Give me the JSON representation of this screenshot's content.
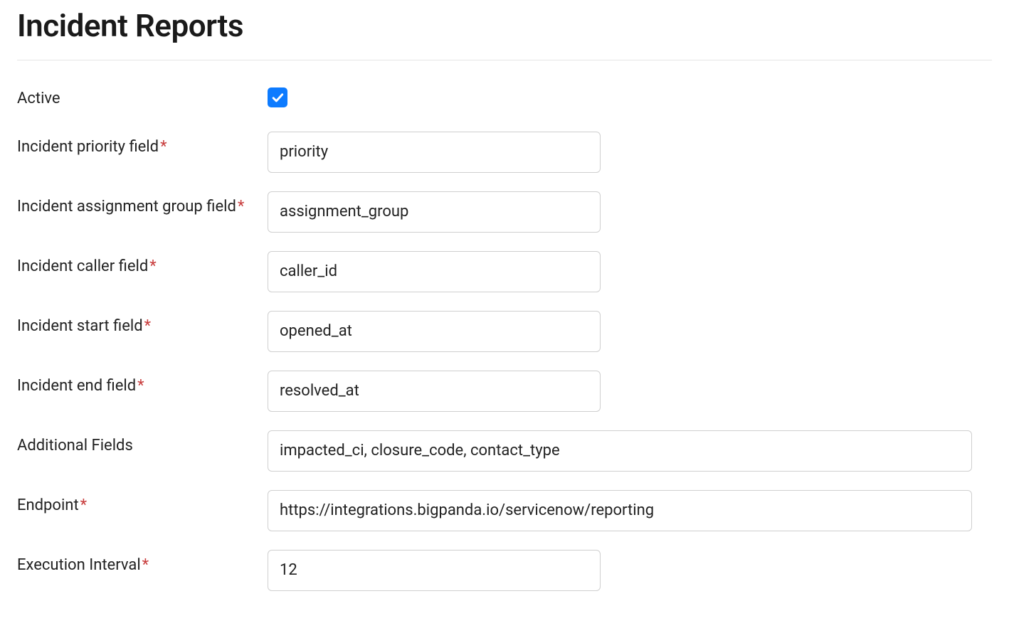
{
  "title": "Incident Reports",
  "fields": {
    "active": {
      "label": "Active",
      "checked": true
    },
    "priority": {
      "label": "Incident priority field",
      "required": true,
      "value": "priority"
    },
    "assignment_group": {
      "label": "Incident assignment group field",
      "required": true,
      "value": "assignment_group"
    },
    "caller": {
      "label": "Incident caller field",
      "required": true,
      "value": "caller_id"
    },
    "start": {
      "label": "Incident start field",
      "required": true,
      "value": "opened_at"
    },
    "end": {
      "label": "Incident end field",
      "required": true,
      "value": "resolved_at"
    },
    "additional": {
      "label": "Additional Fields",
      "required": false,
      "value": "impacted_ci, closure_code, contact_type"
    },
    "endpoint": {
      "label": "Endpoint",
      "required": true,
      "value": "https://integrations.bigpanda.io/servicenow/reporting"
    },
    "interval": {
      "label": "Execution Interval",
      "required": true,
      "value": "12"
    }
  },
  "required_marker": "*"
}
